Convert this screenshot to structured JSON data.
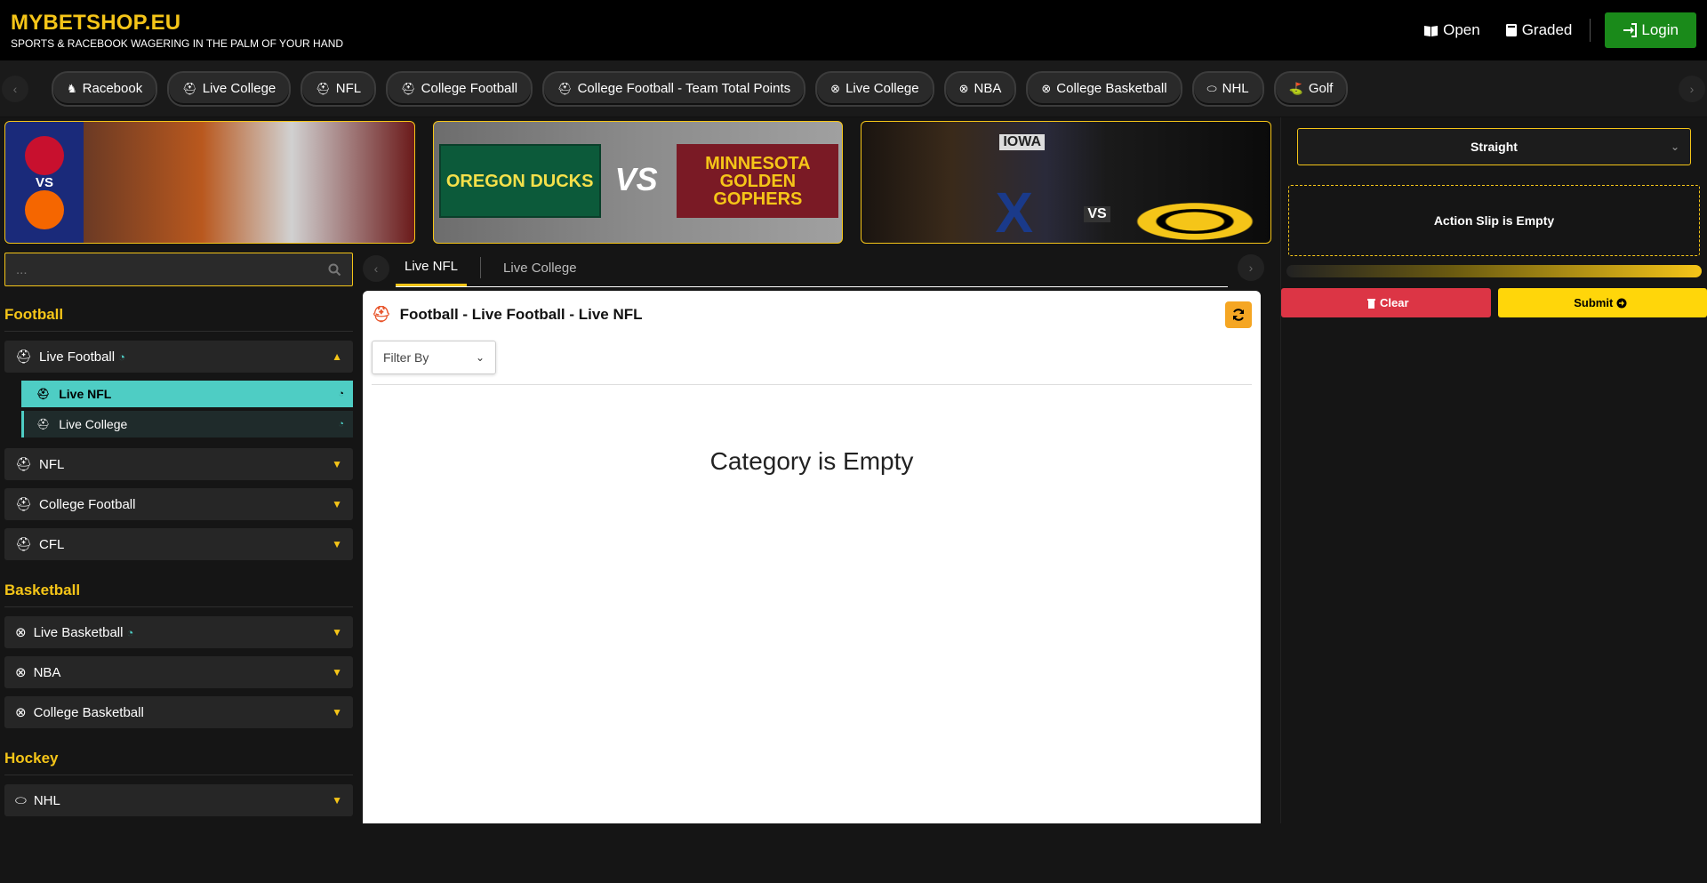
{
  "brand": {
    "title": "MYBETSHOP.EU",
    "subtitle": "SPORTS & RACEBOOK WAGERING IN THE PALM OF YOUR HAND"
  },
  "header": {
    "open_label": "Open",
    "graded_label": "Graded",
    "login_label": "Login"
  },
  "sports_nav": {
    "chips": [
      {
        "label": "Racebook",
        "icon": "horse-icon"
      },
      {
        "label": "Live College",
        "icon": "football-helmet-icon"
      },
      {
        "label": "NFL",
        "icon": "football-helmet-icon"
      },
      {
        "label": "College Football",
        "icon": "football-helmet-icon"
      },
      {
        "label": "College Football - Team Total Points",
        "icon": "football-helmet-icon"
      },
      {
        "label": "Live College",
        "icon": "basketball-icon"
      },
      {
        "label": "NBA",
        "icon": "basketball-icon"
      },
      {
        "label": "College Basketball",
        "icon": "basketball-icon"
      },
      {
        "label": "NHL",
        "icon": "hockey-puck-icon"
      },
      {
        "label": "Golf",
        "icon": "golf-icon"
      }
    ]
  },
  "banners": {
    "banner1": {
      "vs": "VS"
    },
    "banner2": {
      "team1": "OREGON DUCKS",
      "vs": "VS",
      "team2": "MINNESOTA GOLDEN GOPHERS"
    },
    "banner3": {
      "team1": "IOWA",
      "logo": "X",
      "vs": "VS"
    }
  },
  "search": {
    "placeholder": "..."
  },
  "sidebar": {
    "sections": [
      {
        "title": "Football"
      },
      {
        "title": "Basketball"
      },
      {
        "title": "Hockey"
      }
    ],
    "football": {
      "live_football": "Live Football",
      "live_nfl": "Live NFL",
      "live_college": "Live College",
      "nfl": "NFL",
      "college_football": "College Football",
      "cfl": "CFL"
    },
    "basketball": {
      "live_basketball": "Live Basketball",
      "nba": "NBA",
      "college_basketball": "College Basketball"
    },
    "hockey": {
      "nhl": "NHL"
    }
  },
  "tabs": [
    {
      "label": "Live NFL",
      "active": true
    },
    {
      "label": "Live College",
      "active": false
    }
  ],
  "content": {
    "title": "Football - Live Football - Live NFL",
    "filter_label": "Filter By",
    "empty_message": "Category is Empty"
  },
  "slip": {
    "type_selected": "Straight",
    "empty_message": "Action Slip is Empty",
    "clear_label": "Clear",
    "submit_label": "Submit"
  },
  "colors": {
    "accent": "#f5c518",
    "live": "#4ecdc4",
    "login": "#1a8a1a",
    "clear": "#dc3545",
    "submit": "#ffd60a"
  }
}
